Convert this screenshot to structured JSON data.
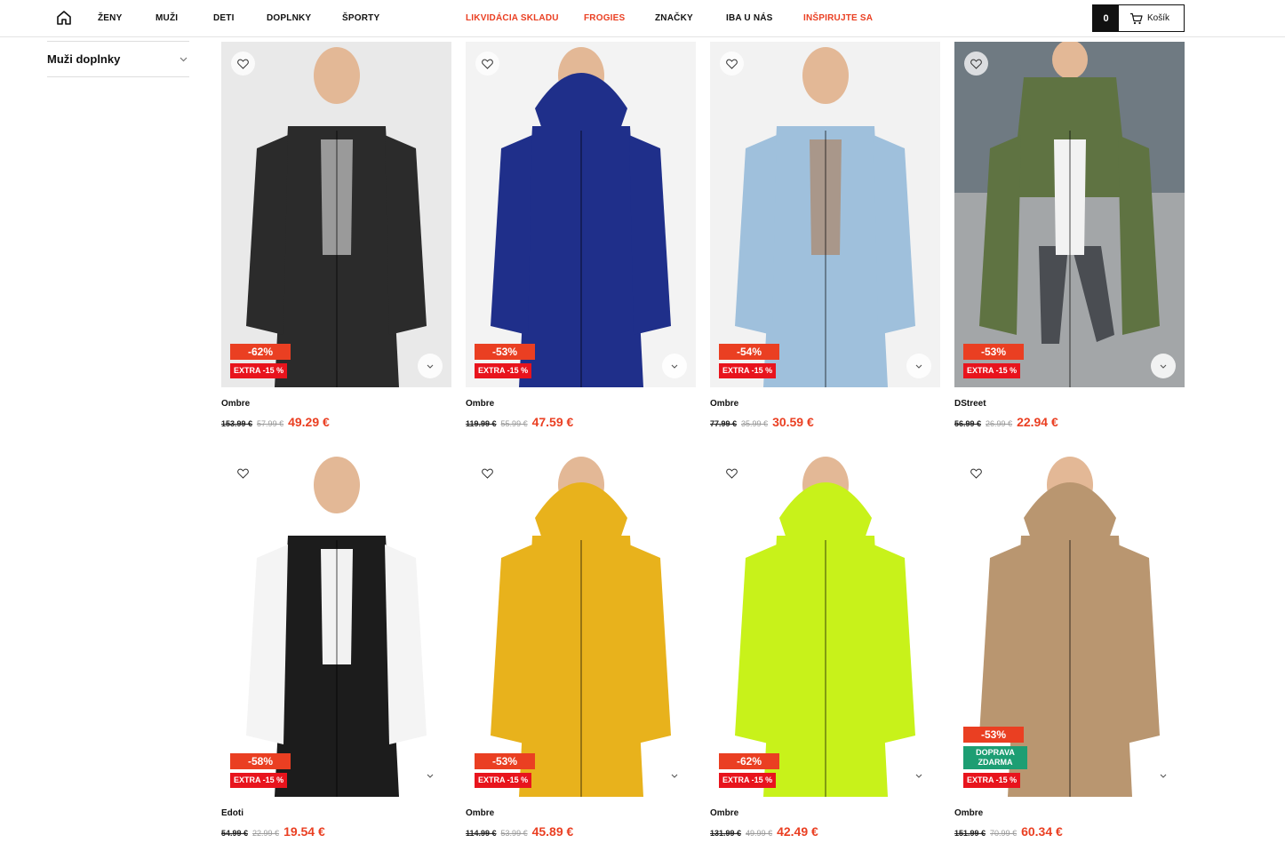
{
  "nav": {
    "items": [
      {
        "label": "ŽENY",
        "accent": false
      },
      {
        "label": "MUŽI",
        "accent": false
      },
      {
        "label": "DETI",
        "accent": false
      },
      {
        "label": "DOPLNKY",
        "accent": false
      },
      {
        "label": "ŠPORTY",
        "accent": false
      },
      {
        "label": "LIKVIDÁCIA SKLADU",
        "accent": true
      },
      {
        "label": "FROGIES",
        "accent": true
      },
      {
        "label": "ZNAČKY",
        "accent": false
      },
      {
        "label": "IBA U NÁS",
        "accent": false
      },
      {
        "label": "INŠPIRUJTE SA",
        "accent": true
      }
    ],
    "cart": {
      "count": "0",
      "label": "Košík"
    }
  },
  "sidebar": {
    "filter_label": "Muži doplnky"
  },
  "colors": {
    "accent": "#ea3f22",
    "extra_badge": "#e8141d",
    "free_badge": "#1d9e73"
  },
  "products": [
    {
      "brand": "Ombre",
      "original_price": "153.99 €",
      "previous_price": "57.99 €",
      "price": "49.29 €",
      "discount": "-62%",
      "extra": "EXTRA -15 %",
      "free_shipping": "",
      "jacket_color": "#2b2b2b",
      "photo": "denim-vest-hoodie"
    },
    {
      "brand": "Ombre",
      "original_price": "119.99 €",
      "previous_price": "55.99 €",
      "price": "47.59 €",
      "discount": "-53%",
      "extra": "EXTRA -15 %",
      "free_shipping": "",
      "jacket_color": "#1f2f8a",
      "photo": "navy-puffer-jacket"
    },
    {
      "brand": "Ombre",
      "original_price": "77.99 €",
      "previous_price": "35.99 €",
      "price": "30.59 €",
      "discount": "-54%",
      "extra": "EXTRA -15 %",
      "free_shipping": "",
      "jacket_color": "#9fc0dc",
      "photo": "light-denim-jacket"
    },
    {
      "brand": "DStreet",
      "original_price": "56.99 €",
      "previous_price": "26.99 €",
      "price": "22.94 €",
      "discount": "-53%",
      "extra": "EXTRA -15 %",
      "free_shipping": "",
      "jacket_color": "#5f7342",
      "photo": "olive-bomber-jacket"
    },
    {
      "brand": "Edoti",
      "original_price": "54.99 €",
      "previous_price": "22.99 €",
      "price": "19.54 €",
      "discount": "-58%",
      "extra": "EXTRA -15 %",
      "free_shipping": "",
      "jacket_color": "#1c1c1c",
      "photo": "black-quilted-vest"
    },
    {
      "brand": "Ombre",
      "original_price": "114.99 €",
      "previous_price": "53.99 €",
      "price": "45.89 €",
      "discount": "-53%",
      "extra": "EXTRA -15 %",
      "free_shipping": "",
      "jacket_color": "#e8b21c",
      "photo": "yellow-puffer-jacket"
    },
    {
      "brand": "Ombre",
      "original_price": "131.99 €",
      "previous_price": "49.99 €",
      "price": "42.49 €",
      "discount": "-62%",
      "extra": "EXTRA -15 %",
      "free_shipping": "",
      "jacket_color": "#c8f21a",
      "photo": "neon-puffer-jacket"
    },
    {
      "brand": "Ombre",
      "original_price": "151.99 €",
      "previous_price": "70.99 €",
      "price": "60.34 €",
      "discount": "-53%",
      "extra": "EXTRA -15 %",
      "free_shipping": "DOPRAVA ZDARMA",
      "jacket_color": "#b99670",
      "photo": "beige-parka"
    }
  ]
}
